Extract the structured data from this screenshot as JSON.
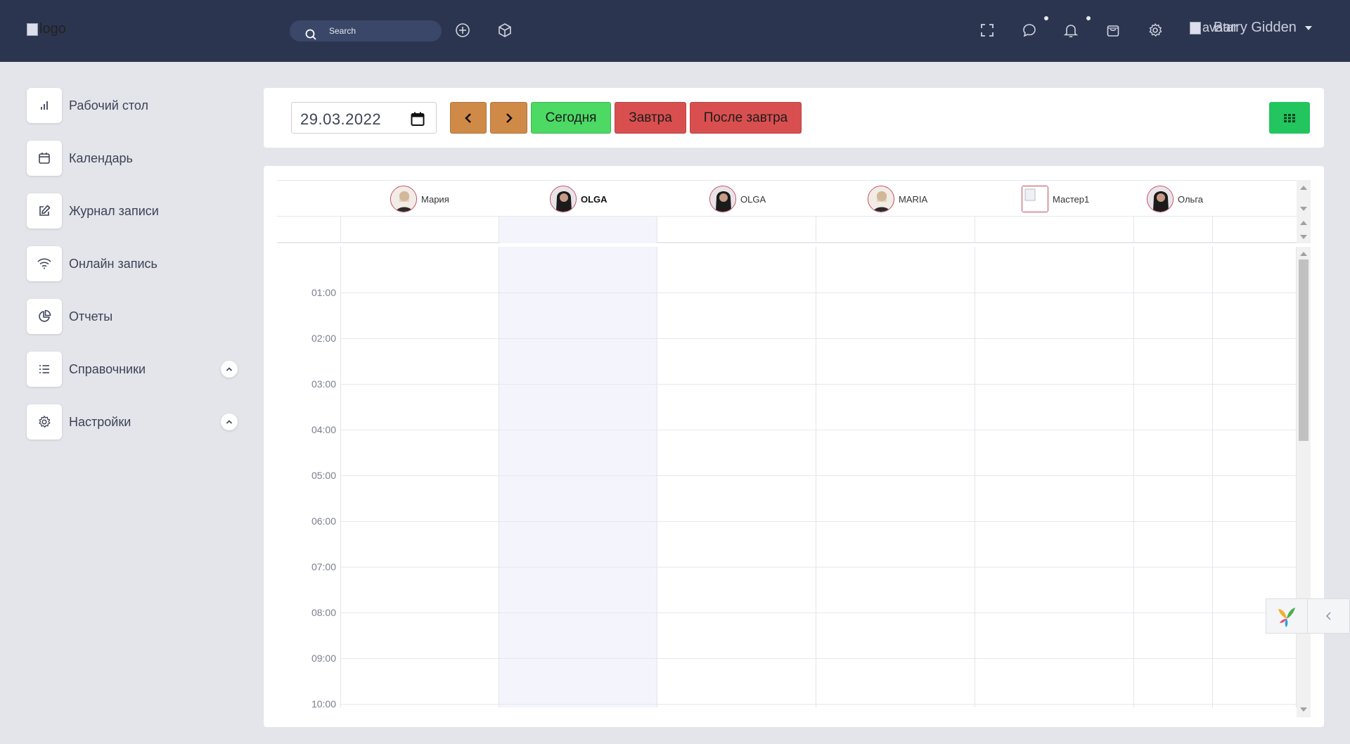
{
  "header": {
    "logo_alt": "logo",
    "search_placeholder": "Search",
    "user_avatar_alt": "avatar",
    "user_name": "Barry Gidden"
  },
  "sidebar": {
    "items": [
      {
        "label": "Рабочий стол",
        "icon": "bar-chart-icon"
      },
      {
        "label": "Календарь",
        "icon": "calendar-icon"
      },
      {
        "label": "Журнал записи",
        "icon": "edit-icon"
      },
      {
        "label": "Онлайн запись",
        "icon": "wifi-icon"
      },
      {
        "label": "Отчеты",
        "icon": "pie-chart-icon"
      },
      {
        "label": "Справочники",
        "icon": "list-icon",
        "expandable": true
      },
      {
        "label": "Настройки",
        "icon": "gear-icon",
        "expandable": true
      }
    ]
  },
  "toolbar": {
    "date_value": "29.03.2022",
    "today_label": "Сегодня",
    "tomorrow_label": "Завтра",
    "after_tomorrow_label": "После завтра"
  },
  "scheduler": {
    "resources": [
      {
        "name": "Мария",
        "bold": false
      },
      {
        "name": "OLGA",
        "bold": true
      },
      {
        "name": "OLGA",
        "bold": false
      },
      {
        "name": "MARIA",
        "bold": false
      },
      {
        "name": "Мастер1",
        "bold": false
      },
      {
        "name": "Ольга",
        "bold": false
      }
    ],
    "times": [
      "01:00",
      "02:00",
      "03:00",
      "04:00",
      "05:00",
      "06:00",
      "07:00",
      "08:00",
      "09:00",
      "10:00"
    ]
  },
  "colors": {
    "topbar": "#2c3550",
    "nav_orange": "#d08a48",
    "today_green": "#4cd964",
    "tomorrow_red": "#d94f4f",
    "grid_green": "#22c55e"
  }
}
